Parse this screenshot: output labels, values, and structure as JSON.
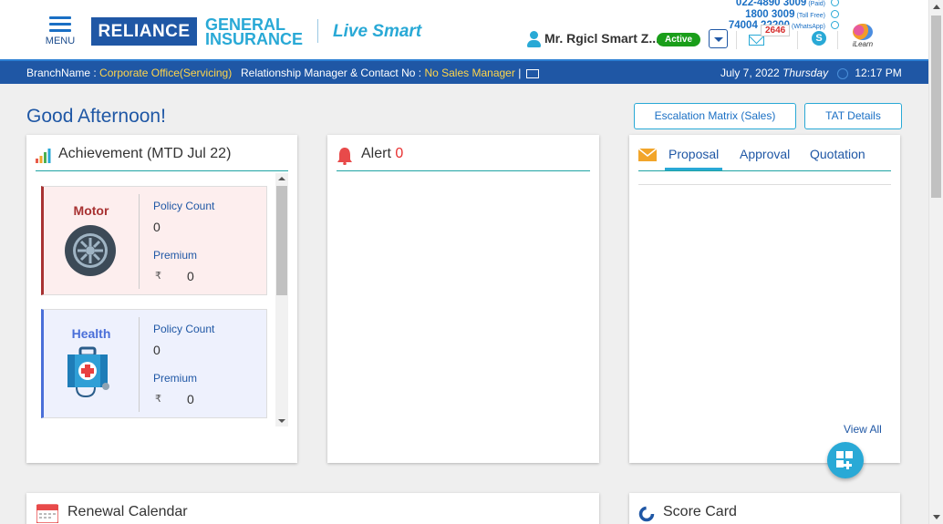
{
  "header": {
    "menu_label": "MENU",
    "logo_brand": "RELIANCE",
    "logo_general": "GENERAL",
    "logo_insurance": "INSURANCE",
    "logo_tagline": "Live Smart",
    "contacts": [
      {
        "number": "022-4890 3009",
        "tag": "(Paid)"
      },
      {
        "number": "1800 3009",
        "tag": "(Toll Free)"
      },
      {
        "number": "74004 22200",
        "tag": "(WhatsApp)"
      }
    ],
    "user_name": "Mr. Rgicl Smart Z...",
    "status_badge": "Active",
    "mail_count": "2646",
    "skype_letter": "S",
    "ilearn_label": "iLearn"
  },
  "infobar": {
    "branch_label": "BranchName :",
    "branch_value": "Corporate Office(Servicing)",
    "rm_label": "Relationship Manager & Contact No :",
    "rm_value": "No Sales Manager",
    "rm_sep": "|",
    "date": "July 7, 2022",
    "day": "Thursday",
    "time": "12:17 PM"
  },
  "greeting": "Good Afternoon!",
  "buttons": {
    "escalation": "Escalation Matrix (Sales)",
    "tat": "TAT Details"
  },
  "achievement": {
    "title": "Achievement (MTD Jul 22)",
    "products": [
      {
        "name": "Motor",
        "policy_count_label": "Policy Count",
        "policy_count": "0",
        "premium_label": "Premium",
        "currency": "₹",
        "premium": "0",
        "accent": "#a83232",
        "bg": "#fdeeee"
      },
      {
        "name": "Health",
        "policy_count_label": "Policy Count",
        "policy_count": "0",
        "premium_label": "Premium",
        "currency": "₹",
        "premium": "0",
        "accent": "#4a6fd9",
        "bg": "#eef1fd"
      }
    ]
  },
  "alert": {
    "title": "Alert",
    "count": "0"
  },
  "proposal_panel": {
    "tabs": [
      "Proposal",
      "Approval",
      "Quotation"
    ],
    "active_tab": "Proposal",
    "view_all": "View All"
  },
  "renewal": {
    "title": "Renewal Calendar"
  },
  "scorecard": {
    "title": "Score Card"
  }
}
